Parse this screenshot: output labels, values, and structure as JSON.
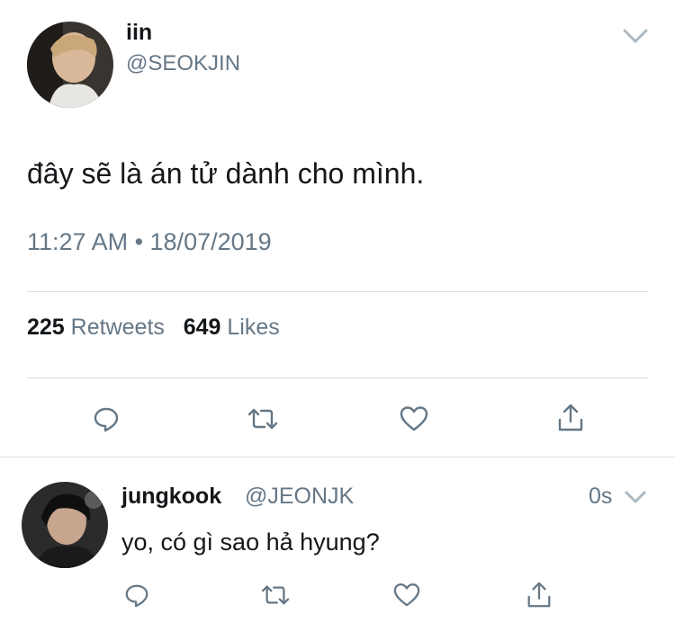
{
  "main_tweet": {
    "display_name": "iin",
    "handle": "@SEOKJIN",
    "text": "đây sẽ là án tử dành cho mình.",
    "timestamp": "11:27 AM • 18/07/2019",
    "stats": {
      "retweets_count": "225",
      "retweets_label": "Retweets",
      "likes_count": "649",
      "likes_label": "Likes"
    },
    "actions": [
      "reply-icon",
      "retweet-icon",
      "like-icon",
      "share-icon"
    ]
  },
  "reply": {
    "display_name": "jungkook",
    "handle": "@JEONJK",
    "time": "0s",
    "text": "yo, có gì sao hả hyung?",
    "actions": [
      "reply-icon",
      "retweet-icon",
      "like-icon",
      "share-icon"
    ]
  },
  "colors": {
    "text": "#14171a",
    "secondary": "#657786",
    "divider": "#d8dde1",
    "icon": "#657786"
  }
}
